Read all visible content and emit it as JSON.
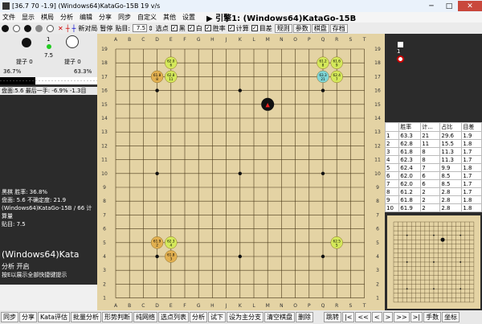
{
  "window": {
    "title": "[36.7 70 -1.9] (Windows64)KataGo-15B 19 v/s",
    "minimize": "─",
    "maximize": "□",
    "close": "✕"
  },
  "menu": {
    "items": [
      "文件",
      "显示",
      "棋局",
      "分析",
      "编辑",
      "分享",
      "同步",
      "自定义",
      "其他",
      "设置"
    ],
    "engine_label": "▶ 引擎1: (Windows64)KataGo-15B"
  },
  "toolbar": {
    "new_game": "新对局",
    "pause": "暂停",
    "komi_label": "贴目:",
    "komi_value": "7.5",
    "select_point": "选点",
    "black": "黑",
    "white": "白",
    "winrate": "胜率",
    "calc": "计算",
    "target": "目差",
    "btns": [
      "规则",
      "参数",
      "棋盘",
      "存档"
    ]
  },
  "left": {
    "black_captures": "提子 0",
    "white_captures": "提子 0",
    "move_label_1": "1",
    "move_label_2": "7.5",
    "winrate_black": "36.7%",
    "winrate_white": "63.3%",
    "score_line": "盘面:5.6 最后一手: -6.9% -1.3目",
    "info_1": "黑棋 胜率: 36.8%",
    "info_2": "盘面: 5.6 不确定度: 21.9",
    "info_3": "(Windows64)KataGo-15B / 66 计算量",
    "info_4": "贴目: 7.5",
    "engine_big": "(Windows64)Kata",
    "analysis_open": "分析 开启",
    "hint": "按E以展示全部快捷键提示"
  },
  "board": {
    "cols": [
      "A",
      "B",
      "C",
      "D",
      "E",
      "F",
      "G",
      "H",
      "J",
      "K",
      "L",
      "M",
      "N",
      "O",
      "P",
      "Q",
      "R",
      "S",
      "T"
    ],
    "rows": [
      "19",
      "18",
      "17",
      "16",
      "15",
      "14",
      "13",
      "12",
      "11",
      "10",
      "9",
      "8",
      "7",
      "6",
      "5",
      "4",
      "3",
      "2",
      "1"
    ],
    "stones": [
      {
        "col": 11,
        "row": 14,
        "color": "black",
        "label": "▲"
      }
    ],
    "candidates": [
      {
        "col": 3,
        "row": 16,
        "color": "#e2b050",
        "wr": "61.8",
        "po": "8"
      },
      {
        "col": 4,
        "row": 16,
        "color": "#d4e85a",
        "wr": "62.8",
        "po": "11"
      },
      {
        "col": 4,
        "row": 17,
        "color": "#d4e85a",
        "wr": "62.0",
        "po": "6"
      },
      {
        "col": 15,
        "row": 16,
        "color": "#7fd6d6",
        "wr": "63.3",
        "po": "21"
      },
      {
        "col": 16,
        "row": 16,
        "color": "#d4e85a",
        "wr": "62.4",
        "po": "7"
      },
      {
        "col": 16,
        "row": 17,
        "color": "#d4e85a",
        "wr": "61.6",
        "po": "9"
      },
      {
        "col": 15,
        "row": 17,
        "color": "#d4e85a",
        "wr": "61.2",
        "po": "8"
      },
      {
        "col": 3,
        "row": 4,
        "color": "#e2b050",
        "wr": "61.9",
        "po": "2"
      },
      {
        "col": 4,
        "row": 4,
        "color": "#d4e85a",
        "wr": "62.3",
        "po": "4"
      },
      {
        "col": 4,
        "row": 3,
        "color": "#e2b050",
        "wr": "61.8",
        "po": "3"
      },
      {
        "col": 16,
        "row": 4,
        "color": "#d4e85a",
        "wr": "62.5",
        "po": "5"
      }
    ]
  },
  "table": {
    "headers": [
      "",
      "胜率",
      "计...",
      "占比",
      "目差"
    ],
    "rows": [
      [
        "1",
        "63.3",
        "21",
        "29.6",
        "1.9"
      ],
      [
        "2",
        "62.8",
        "11",
        "15.5",
        "1.8"
      ],
      [
        "3",
        "61.8",
        "8",
        "11.3",
        "1.7"
      ],
      [
        "4",
        "62.3",
        "8",
        "11.3",
        "1.7"
      ],
      [
        "5",
        "62.4",
        "7",
        "9.9",
        "1.8"
      ],
      [
        "6",
        "62.0",
        "6",
        "8.5",
        "1.7"
      ],
      [
        "7",
        "62.0",
        "6",
        "8.5",
        "1.7"
      ],
      [
        "8",
        "61.2",
        "2",
        "2.8",
        "1.7"
      ],
      [
        "9",
        "61.8",
        "2",
        "2.8",
        "1.8"
      ],
      [
        "10",
        "61.9",
        "2",
        "2.8",
        "1.8"
      ]
    ]
  },
  "right": {
    "move_no": "1"
  },
  "bottom": {
    "btns": [
      "同步",
      "分享",
      "Kata评估",
      "批量分析",
      "形势判断",
      "纯网络",
      "选点列表",
      "分析",
      "试下",
      "设为主分支",
      "清空棋盘",
      "删除"
    ],
    "nav": [
      "跳转",
      "|<",
      "<<",
      "<",
      ">",
      ">>",
      ">|",
      "手数",
      "坐标"
    ]
  },
  "colors": {
    "board": "#e4d3a4",
    "line": "#4a3a1a",
    "panel": "#2b2b2b"
  }
}
